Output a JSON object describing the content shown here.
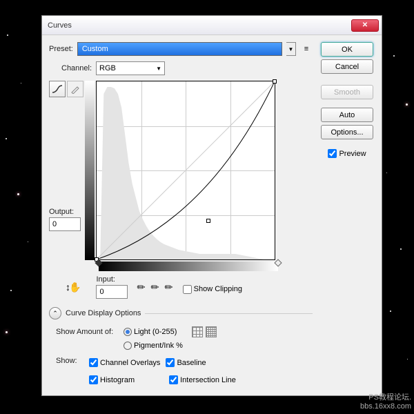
{
  "title": "Curves",
  "preset": {
    "label": "Preset:",
    "value": "Custom"
  },
  "channel": {
    "label": "Channel:",
    "value": "RGB"
  },
  "output": {
    "label": "Output:",
    "value": "0"
  },
  "input": {
    "label": "Input:",
    "value": "0"
  },
  "show_clipping": "Show Clipping",
  "curve_display_options": "Curve Display Options",
  "show_amount": {
    "label": "Show Amount of:",
    "light": "Light (0-255)",
    "pigment": "Pigment/Ink %"
  },
  "show": {
    "label": "Show:",
    "channel_overlays": "Channel Overlays",
    "histogram": "Histogram",
    "baseline": "Baseline",
    "intersection": "Intersection Line"
  },
  "buttons": {
    "ok": "OK",
    "cancel": "Cancel",
    "smooth": "Smooth",
    "auto": "Auto",
    "options": "Options..."
  },
  "preview": "Preview",
  "watermark": {
    "l1": "PS教程论坛.",
    "l2": "bbs.16xx8.com"
  },
  "chart_data": {
    "type": "curves",
    "xlabel": "Input",
    "ylabel": "Output",
    "xlim": [
      0,
      255
    ],
    "ylim": [
      0,
      255
    ],
    "baseline": [
      [
        0,
        0
      ],
      [
        255,
        255
      ]
    ],
    "curve_points": [
      [
        0,
        0
      ],
      [
        160,
        55
      ],
      [
        255,
        255
      ]
    ],
    "handles": [
      [
        0,
        0
      ],
      [
        160,
        55
      ],
      [
        255,
        255
      ]
    ],
    "histogram_bins": [
      0,
      0,
      240,
      250,
      250,
      248,
      240,
      220,
      180,
      140,
      110,
      90,
      70,
      58,
      48,
      40,
      34,
      29,
      25,
      22,
      20,
      18,
      16,
      14,
      13,
      12,
      11,
      10,
      9,
      8,
      8,
      8,
      8,
      8,
      8,
      8,
      8,
      8,
      8,
      8,
      7,
      6,
      5,
      4,
      3,
      2,
      1,
      0,
      0,
      0
    ],
    "sliders": {
      "black": 0,
      "white": 255
    }
  }
}
